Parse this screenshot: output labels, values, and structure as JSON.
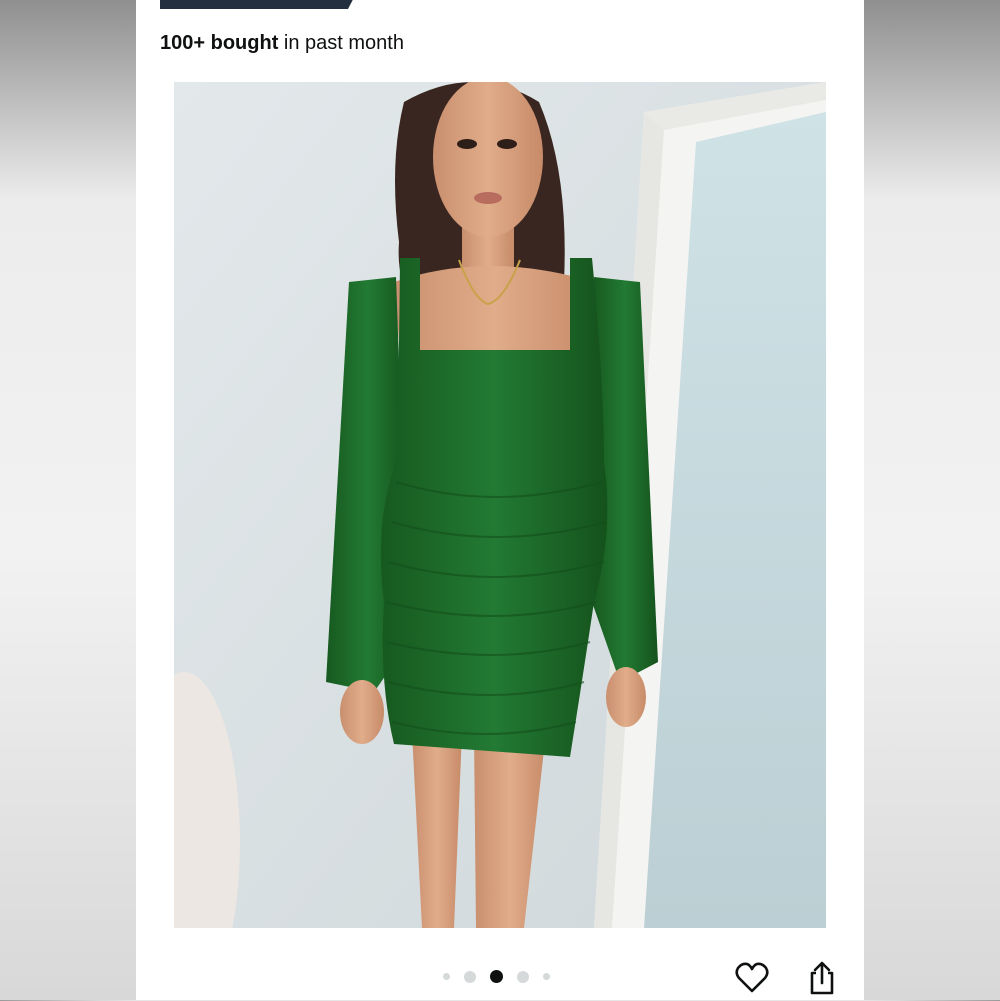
{
  "listing": {
    "bought_bold": "100+ bought",
    "bought_rest": " in past month"
  },
  "gallery": {
    "image_count": 5,
    "active_index": 2,
    "image_alt": "Green long sleeve ruched bodycon mini dress"
  },
  "actions": {
    "favorite_icon": "heart-icon",
    "share_icon": "share-icon"
  },
  "colors": {
    "dress_green": "#1f6b2e",
    "badge_navy": "#232f3e",
    "text_dark": "#0f1111",
    "dot_inactive": "#d5d9d9"
  }
}
